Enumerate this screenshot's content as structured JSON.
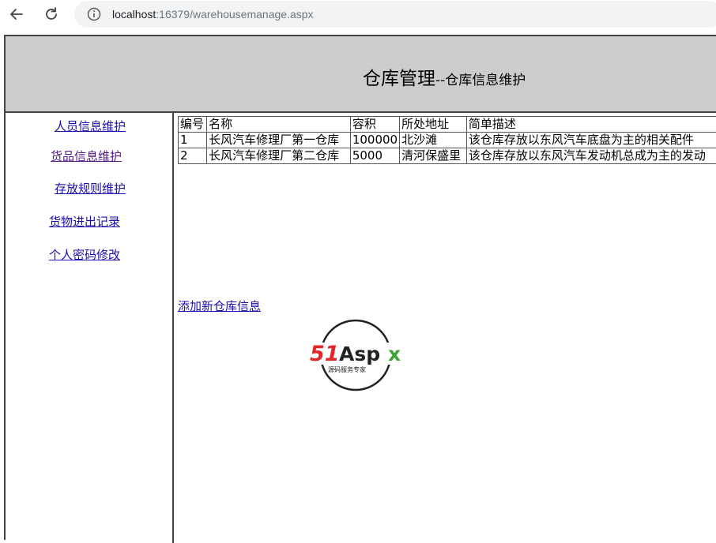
{
  "browser": {
    "url_host": "localhost",
    "url_rest": ":16379/warehousemanage.aspx",
    "icons": [
      "back-arrow-icon",
      "reload-icon",
      "info-icon"
    ]
  },
  "header": {
    "title": "仓库管理",
    "subtitle": "--仓库信息维护"
  },
  "sidebar": {
    "items": [
      {
        "label": "人员信息维护"
      },
      {
        "label": "货品信息维护"
      },
      {
        "label": "存放规则维护"
      },
      {
        "label": "货物进出记录"
      },
      {
        "label": "个人密码修改"
      }
    ]
  },
  "table": {
    "columns": [
      "编号",
      "名称",
      "容积",
      "所处地址",
      "简单描述"
    ],
    "rows": [
      [
        "1",
        "长风汽车修理厂第一仓库",
        "100000",
        "北沙滩",
        "该仓库存放以东风汽车底盘为主的相关配件"
      ],
      [
        "2",
        "长风汽车修理厂第二仓库",
        "5000",
        "清河保盛里",
        "该仓库存放以东风汽车发动机总成为主的发动"
      ]
    ]
  },
  "add_link": "添加新仓库信息",
  "logo": {
    "main_text": "51Aspx",
    "tagline": "源码服务专家",
    "colors": {
      "red": "#e3262b",
      "dark": "#222222",
      "green": "#3aa535"
    }
  },
  "colors": {
    "header_bg": "#cccccc",
    "link": "#1a0dab",
    "visited_link": "#551a8b"
  }
}
